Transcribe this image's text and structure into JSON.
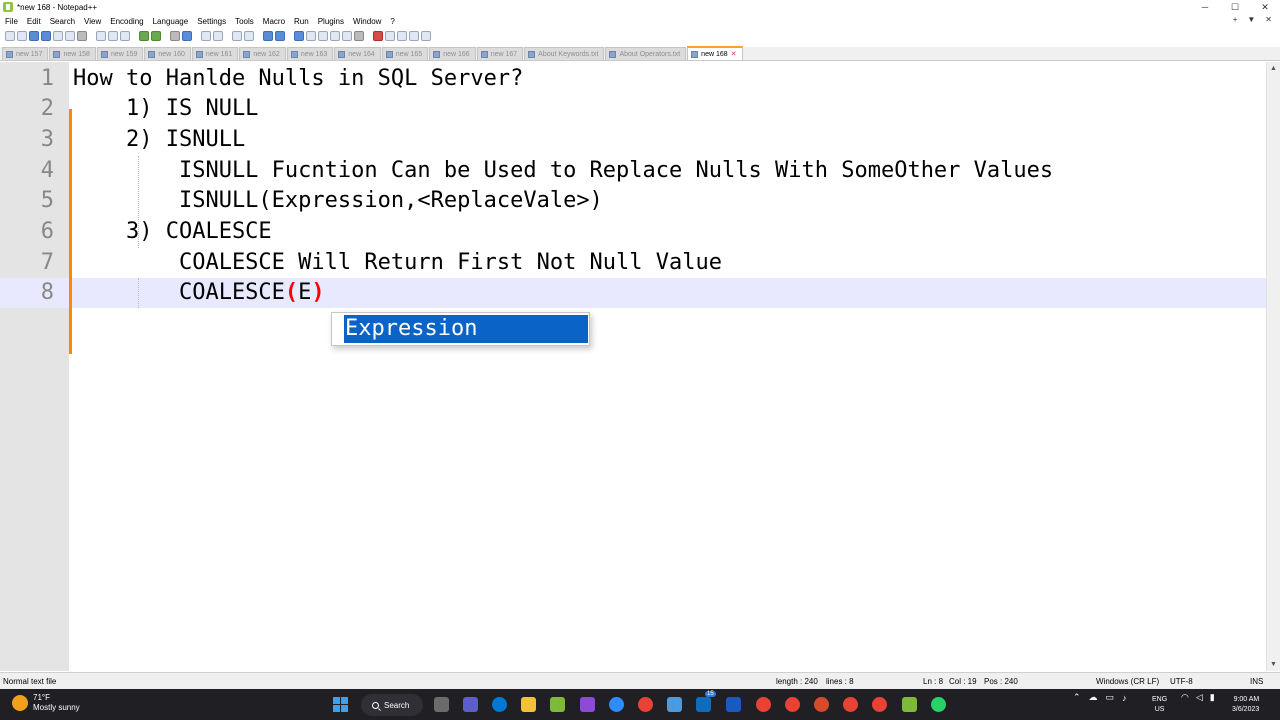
{
  "window": {
    "title": "*new 168 - Notepad++",
    "controls": {
      "minimize": "─",
      "maximize": "☐",
      "close": "✕"
    }
  },
  "menu": {
    "items": [
      "File",
      "Edit",
      "Search",
      "View",
      "Encoding",
      "Language",
      "Settings",
      "Tools",
      "Macro",
      "Run",
      "Plugins",
      "Window",
      "?"
    ],
    "right": {
      "plus": "+",
      "dropdown": "▼",
      "close": "✕"
    }
  },
  "tabs": [
    {
      "label": "new 157",
      "active": false
    },
    {
      "label": "new 158",
      "active": false
    },
    {
      "label": "new 159",
      "active": false
    },
    {
      "label": "new 160",
      "active": false
    },
    {
      "label": "new 161",
      "active": false
    },
    {
      "label": "new 162",
      "active": false
    },
    {
      "label": "new 163",
      "active": false
    },
    {
      "label": "new 164",
      "active": false
    },
    {
      "label": "new 165",
      "active": false
    },
    {
      "label": "new 166",
      "active": false
    },
    {
      "label": "new 167",
      "active": false
    },
    {
      "label": "About Keywords.txt",
      "active": false
    },
    {
      "label": "About Operators.txt",
      "active": false
    },
    {
      "label": "new 168",
      "active": true
    }
  ],
  "editor": {
    "line_numbers": [
      "1",
      "2",
      "3",
      "4",
      "5",
      "6",
      "7",
      "8"
    ],
    "lines": [
      "How to Hanlde Nulls in SQL Server?",
      "    1) IS NULL",
      "    2) ISNULL",
      "        ISNULL Fucntion Can be Used to Replace Nulls With SomeOther Values",
      "        ISNULL(Expression,<ReplaceVale>)",
      "    3) COALESCE",
      "        COALESCE Will Return First Not Null Value"
    ],
    "current_line": {
      "prefix": "        COALESCE",
      "open_brace": "(",
      "typed": "E",
      "close_brace": ")"
    },
    "autocomplete": {
      "suggestion": "Expression"
    },
    "mouse_cursor": "I"
  },
  "statusbar": {
    "file_type": "Normal text file",
    "length": "length : 240",
    "lines": "lines : 8",
    "ln": "Ln : 8",
    "col": "Col : 19",
    "pos": "Pos : 240",
    "eol": "Windows (CR LF)",
    "encoding": "UTF-8",
    "mode": "INS"
  },
  "taskbar": {
    "weather_temp": "71°F",
    "weather_desc": "Mostly sunny",
    "search_label": "Search",
    "lang_primary": "ENG",
    "lang_secondary": "US",
    "time": "9:00 AM",
    "date": "3/6/2023",
    "badge": "15"
  },
  "colors": {
    "active_tab_accent": "#f5a623",
    "change_bar": "#ff8a00",
    "current_line_bg": "#e8e8ff",
    "brace_highlight": "#ff0000",
    "autocomplete_selection": "#0a64c8",
    "taskbar_bg": "#1f1f24"
  }
}
